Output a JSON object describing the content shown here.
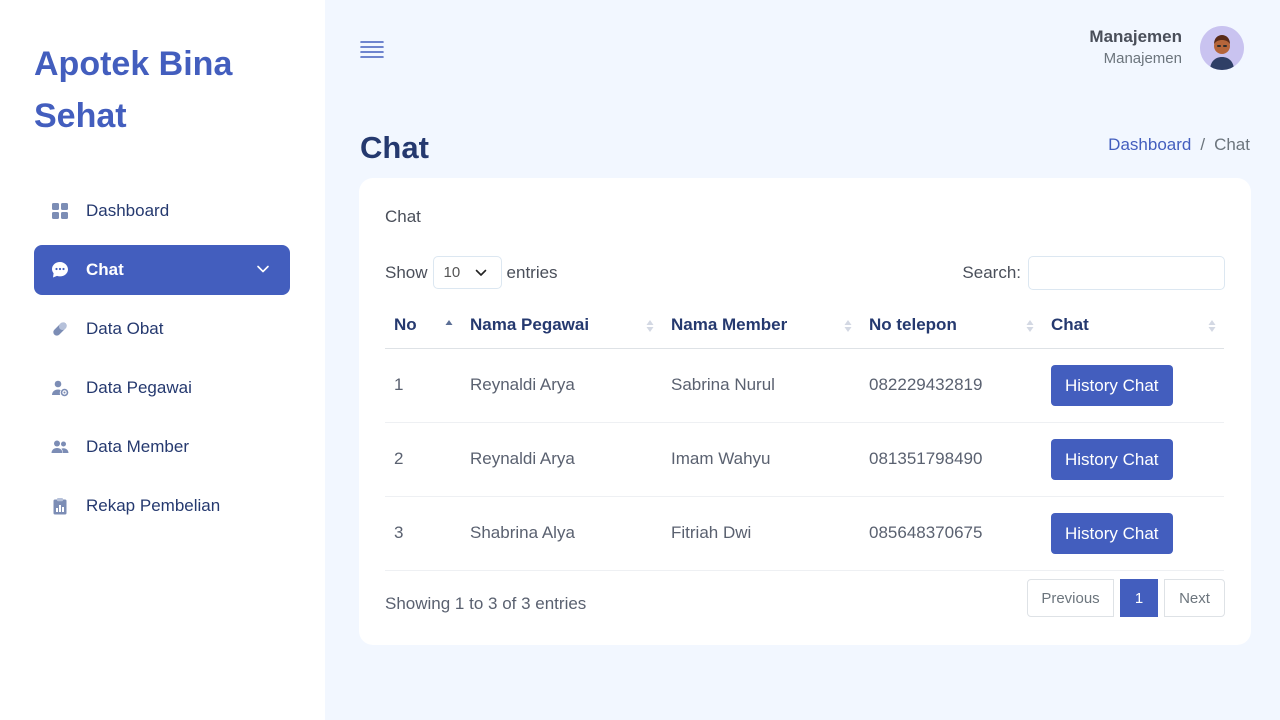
{
  "brand": "Apotek Bina Sehat",
  "sidebar": {
    "items": [
      {
        "label": "Dashboard",
        "icon": "grid-icon"
      },
      {
        "label": "Chat",
        "icon": "chat-icon",
        "active": true
      },
      {
        "label": "Data Obat",
        "icon": "pill-icon"
      },
      {
        "label": "Data Pegawai",
        "icon": "user-gear-icon"
      },
      {
        "label": "Data Member",
        "icon": "people-icon"
      },
      {
        "label": "Rekap Pembelian",
        "icon": "clipboard-chart-icon"
      }
    ]
  },
  "header": {
    "user_name": "Manajemen",
    "user_role": "Manajemen"
  },
  "page": {
    "title": "Chat",
    "breadcrumb": [
      "Dashboard",
      "Chat"
    ],
    "separator": "/"
  },
  "card": {
    "title": "Chat",
    "show_label": "Show",
    "entries_label": "entries",
    "page_length": "10",
    "search_label": "Search:",
    "search_value": "",
    "columns": [
      "No",
      "Nama Pegawai",
      "Nama Member",
      "No telepon",
      "Chat"
    ],
    "rows": [
      {
        "no": "1",
        "pegawai": "Reynaldi Arya",
        "member": "Sabrina Nurul",
        "telepon": "082229432819",
        "action": "History Chat"
      },
      {
        "no": "2",
        "pegawai": "Reynaldi Arya",
        "member": "Imam Wahyu",
        "telepon": "081351798490",
        "action": "History Chat"
      },
      {
        "no": "3",
        "pegawai": "Shabrina Alya",
        "member": "Fitriah Dwi",
        "telepon": "085648370675",
        "action": "History Chat"
      }
    ],
    "info": "Showing 1 to 3 of 3 entries",
    "pagination": {
      "previous": "Previous",
      "current": "1",
      "next": "Next"
    }
  },
  "colors": {
    "accent": "#435ebe",
    "background": "#f2f7ff",
    "title": "#25396f"
  }
}
